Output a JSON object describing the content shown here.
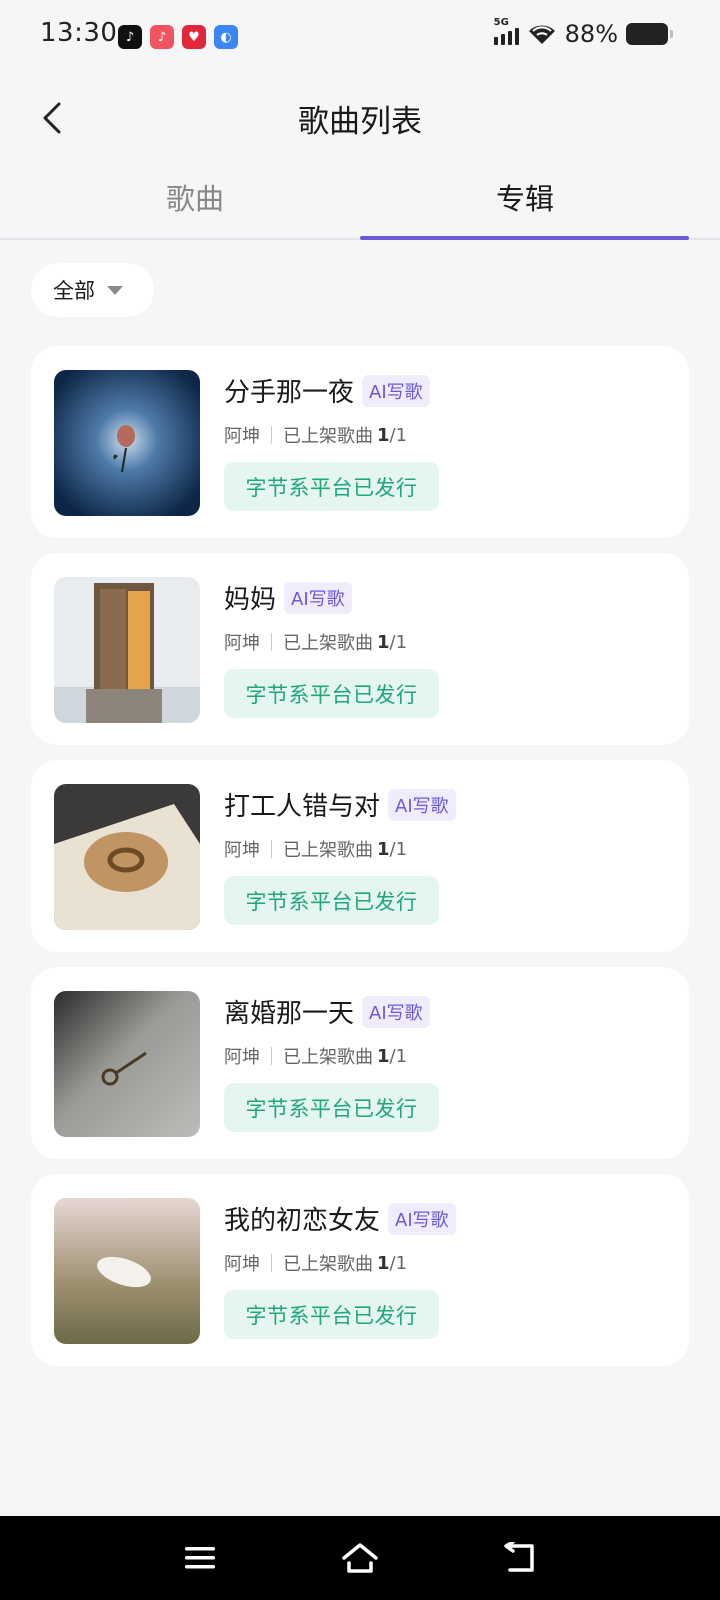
{
  "status": {
    "time": "13:30",
    "network": "5G",
    "battery": "88%",
    "apps": [
      {
        "name": "qq-music-icon",
        "color": "#111111",
        "glyph": "♪"
      },
      {
        "name": "douyin-music-icon",
        "color": "#f0555f",
        "glyph": "♪"
      },
      {
        "name": "heart-app-icon",
        "color": "#e0283a",
        "glyph": "♥"
      },
      {
        "name": "blue-app-icon",
        "color": "#3b86f0",
        "glyph": "◐"
      }
    ]
  },
  "header": {
    "title": "歌曲列表"
  },
  "tabs": [
    {
      "label": "歌曲",
      "active": false
    },
    {
      "label": "专辑",
      "active": true
    }
  ],
  "filter": {
    "label": "全部"
  },
  "albums": [
    {
      "title": "分手那一夜",
      "badge": "AI写歌",
      "artist": "阿坤",
      "status_label": "已上架歌曲",
      "count": "1",
      "total": "/1",
      "release": "字节系平台已发行",
      "cover": "rose"
    },
    {
      "title": "妈妈",
      "badge": "AI写歌",
      "artist": "阿坤",
      "status_label": "已上架歌曲",
      "count": "1",
      "total": "/1",
      "release": "字节系平台已发行",
      "cover": "door"
    },
    {
      "title": "打工人错与对",
      "badge": "AI写歌",
      "artist": "阿坤",
      "status_label": "已上架歌曲",
      "count": "1",
      "total": "/1",
      "release": "字节系平台已发行",
      "cover": "ring"
    },
    {
      "title": "离婚那一天",
      "badge": "AI写歌",
      "artist": "阿坤",
      "status_label": "已上架歌曲",
      "count": "1",
      "total": "/1",
      "release": "字节系平台已发行",
      "cover": "key"
    },
    {
      "title": "我的初恋女友",
      "badge": "AI写歌",
      "artist": "阿坤",
      "status_label": "已上架歌曲",
      "count": "1",
      "total": "/1",
      "release": "字节系平台已发行",
      "cover": "petal"
    }
  ],
  "colors": {
    "accent": "#6a5ad8",
    "release_text": "#1fa77a",
    "release_bg": "#e4f6ef"
  }
}
